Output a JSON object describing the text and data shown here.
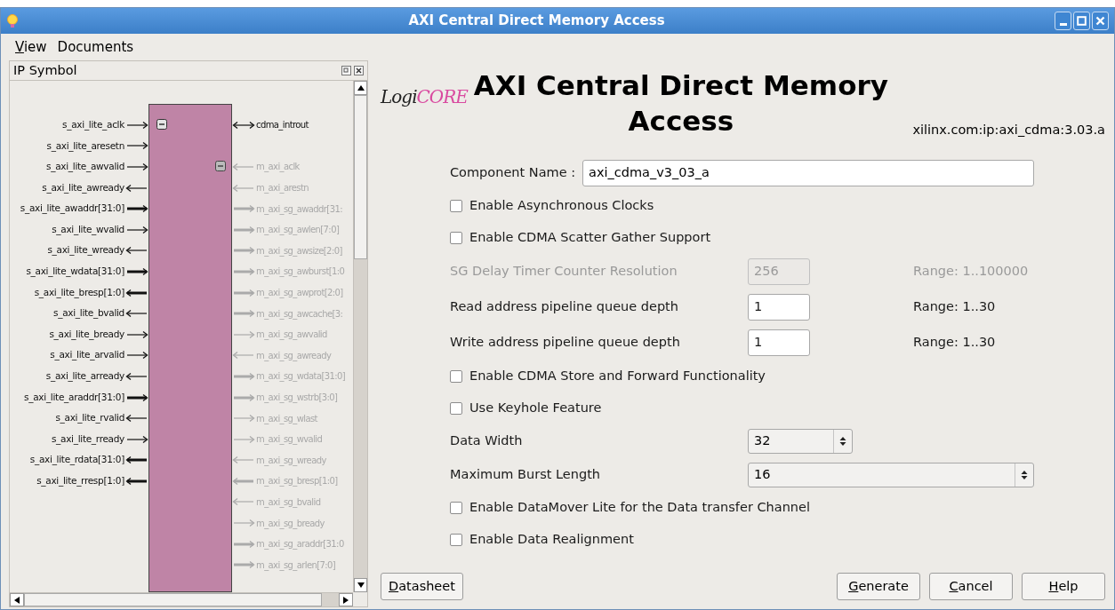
{
  "window": {
    "title": "AXI Central Direct Memory Access"
  },
  "menu": [
    {
      "mnemonic": "V",
      "rest": "iew"
    },
    {
      "label": "Documents"
    }
  ],
  "ip_symbol": {
    "title": "IP Symbol",
    "left_pins": [
      {
        "name": "s_axi_lite_aclk",
        "kind": "in"
      },
      {
        "name": "s_axi_lite_aresetn",
        "kind": "in"
      },
      {
        "name": "s_axi_lite_awvalid",
        "kind": "in"
      },
      {
        "name": "s_axi_lite_awready",
        "kind": "out"
      },
      {
        "name": "s_axi_lite_awaddr[31:0]",
        "kind": "inbus"
      },
      {
        "name": "s_axi_lite_wvalid",
        "kind": "in"
      },
      {
        "name": "s_axi_lite_wready",
        "kind": "out"
      },
      {
        "name": "s_axi_lite_wdata[31:0]",
        "kind": "inbus"
      },
      {
        "name": "s_axi_lite_bresp[1:0]",
        "kind": "outbus"
      },
      {
        "name": "s_axi_lite_bvalid",
        "kind": "out"
      },
      {
        "name": "s_axi_lite_bready",
        "kind": "in"
      },
      {
        "name": "s_axi_lite_arvalid",
        "kind": "in"
      },
      {
        "name": "s_axi_lite_arready",
        "kind": "out"
      },
      {
        "name": "s_axi_lite_araddr[31:0]",
        "kind": "inbus"
      },
      {
        "name": "s_axi_lite_rvalid",
        "kind": "out"
      },
      {
        "name": "s_axi_lite_rready",
        "kind": "in"
      },
      {
        "name": "s_axi_lite_rdata[31:0]",
        "kind": "outbus"
      },
      {
        "name": "s_axi_lite_rresp[1:0]",
        "kind": "outbus"
      }
    ],
    "right_groups": [
      {
        "pins": [
          {
            "name": "cdma_introut",
            "kind": "inout",
            "disabled": false
          }
        ]
      },
      {
        "pins": [
          {
            "name": "m_axi_aclk",
            "kind": "in",
            "disabled": true
          },
          {
            "name": "m_axi_arestn",
            "kind": "in",
            "disabled": true
          },
          {
            "name": "m_axi_sg_awaddr[31:",
            "kind": "outbus",
            "disabled": true
          },
          {
            "name": "m_axi_sg_awlen[7:0]",
            "kind": "outbus",
            "disabled": true
          },
          {
            "name": "m_axi_sg_awsize[2:0]",
            "kind": "outbus",
            "disabled": true
          },
          {
            "name": "m_axi_sg_awburst[1:0",
            "kind": "outbus",
            "disabled": true
          },
          {
            "name": "m_axi_sg_awprot[2:0]",
            "kind": "outbus",
            "disabled": true
          },
          {
            "name": "m_axi_sg_awcache[3:",
            "kind": "outbus",
            "disabled": true
          },
          {
            "name": "m_axi_sg_awvalid",
            "kind": "out",
            "disabled": true
          },
          {
            "name": "m_axi_sg_awready",
            "kind": "in",
            "disabled": true
          },
          {
            "name": "m_axi_sg_wdata[31:0]",
            "kind": "outbus",
            "disabled": true
          },
          {
            "name": "m_axi_sg_wstrb[3:0]",
            "kind": "outbus",
            "disabled": true
          },
          {
            "name": "m_axi_sg_wlast",
            "kind": "out",
            "disabled": true
          },
          {
            "name": "m_axi_sg_wvalid",
            "kind": "out",
            "disabled": true
          },
          {
            "name": "m_axi_sg_wready",
            "kind": "in",
            "disabled": true
          },
          {
            "name": "m_axi_sg_bresp[1:0]",
            "kind": "inbus",
            "disabled": true
          },
          {
            "name": "m_axi_sg_bvalid",
            "kind": "in",
            "disabled": true
          },
          {
            "name": "m_axi_sg_bready",
            "kind": "out",
            "disabled": true
          },
          {
            "name": "m_axi_sg_araddr[31:0",
            "kind": "outbus",
            "disabled": true
          },
          {
            "name": "m_axi_sg_arlen[7:0]",
            "kind": "outbus",
            "disabled": true
          }
        ]
      }
    ]
  },
  "header": {
    "logo": {
      "part_1": "Logi",
      "part_2": "CORE"
    },
    "title": "AXI Central Direct Memory Access",
    "vlnv": "xilinx.com:ip:axi_cdma:3.03.a"
  },
  "form": [
    {
      "kind": "text",
      "label": "Component Name :",
      "value": "axi_cdma_v3_03_a"
    },
    {
      "kind": "checkbox",
      "label": "Enable Asynchronous Clocks",
      "checked": false
    },
    {
      "kind": "checkbox",
      "label": "Enable CDMA Scatter Gather Support",
      "checked": false
    },
    {
      "kind": "number",
      "label": "SG Delay Timer Counter Resolution",
      "value": "256",
      "range": "Range: 1..100000",
      "disabled": true
    },
    {
      "kind": "number",
      "label": "Read address pipeline queue depth",
      "value": "1",
      "range": "Range: 1..30",
      "disabled": false
    },
    {
      "kind": "number",
      "label": "Write address pipeline queue depth",
      "value": "1",
      "range": "Range: 1..30",
      "disabled": false
    },
    {
      "kind": "checkbox",
      "label": "Enable CDMA Store and Forward Functionality",
      "checked": false
    },
    {
      "kind": "checkbox",
      "label": "Use Keyhole Feature",
      "checked": false
    },
    {
      "kind": "spin",
      "label": "Data Width",
      "value": "32"
    },
    {
      "kind": "select",
      "label": "Maximum Burst Length",
      "value": "16"
    },
    {
      "kind": "checkbox",
      "label": "Enable DataMover Lite for the Data transfer Channel",
      "checked": false
    },
    {
      "kind": "checkbox",
      "label": "Enable Data Realignment",
      "checked": false
    }
  ],
  "buttons": [
    {
      "mnemonic": "D",
      "rest": "atasheet",
      "kind": "left"
    },
    {
      "mnemonic": "G",
      "rest": "enerate",
      "kind": "right"
    },
    {
      "mnemonic": "C",
      "rest": "ancel",
      "kind": "right"
    },
    {
      "mnemonic": "H",
      "rest": "elp",
      "kind": "right"
    }
  ]
}
